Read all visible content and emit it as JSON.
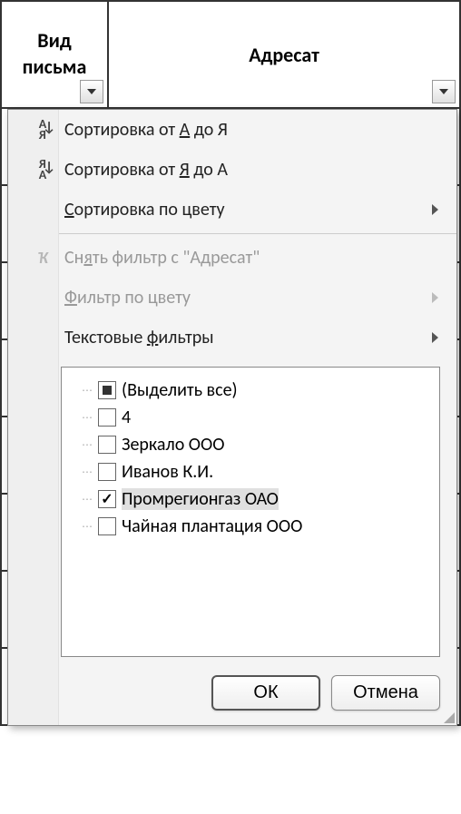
{
  "columns": {
    "a": {
      "label_line1": "Вид",
      "label_line2": "письма"
    },
    "b": {
      "label": "Адресат"
    }
  },
  "menu": {
    "sort_asc": {
      "prefix": "Сортировка от ",
      "uchar": "А",
      "suffix": " до Я"
    },
    "sort_desc": {
      "prefix": "Сортировка от ",
      "uchar": "Я",
      "suffix": " до А"
    },
    "sort_by_color": {
      "uchar": "С",
      "suffix": "ортировка по цвету"
    },
    "clear_filter": {
      "prefix": "Сн",
      "uchar": "я",
      "suffix": "ть фильтр с \"Адресат\""
    },
    "filter_by_color": {
      "uchar": "Ф",
      "suffix": "ильтр по цвету"
    },
    "text_filters": {
      "prefix": "Текстовые ",
      "uchar": "ф",
      "suffix": "ильтры"
    }
  },
  "filter_values": {
    "select_all": "(Выделить все)",
    "items": [
      {
        "label": "4",
        "checked": false
      },
      {
        "label": "Зеркало ООО",
        "checked": false
      },
      {
        "label": "Иванов К.И.",
        "checked": false
      },
      {
        "label": "Промрегионгаз ОАО",
        "checked": true,
        "highlighted": true
      },
      {
        "label": "Чайная плантация ООО",
        "checked": false
      }
    ]
  },
  "buttons": {
    "ok": "ОК",
    "cancel": "Отмена"
  }
}
